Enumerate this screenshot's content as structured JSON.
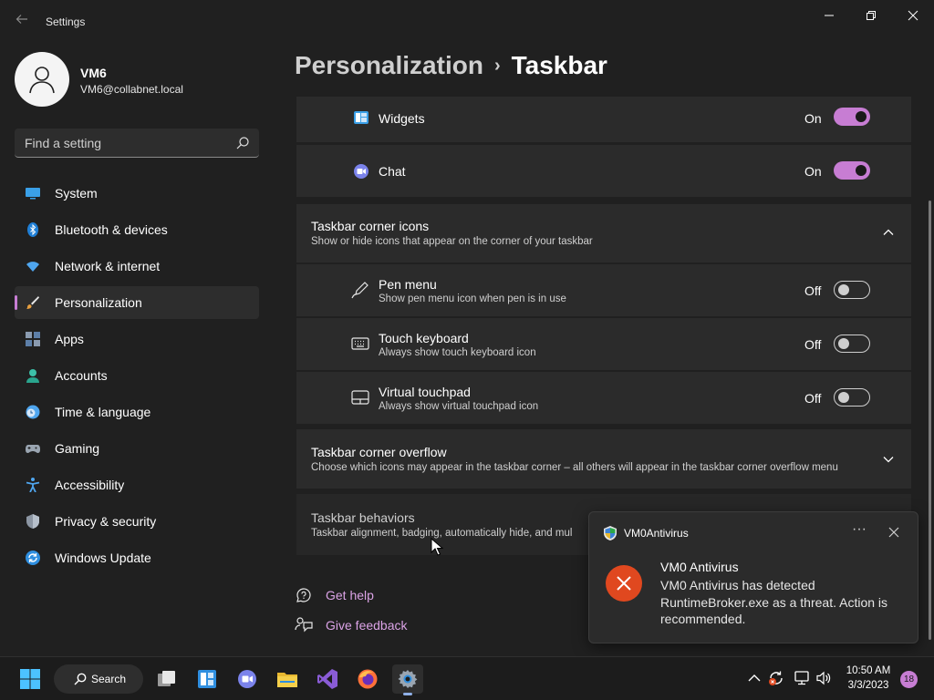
{
  "window": {
    "title": "Settings"
  },
  "user": {
    "name": "VM6",
    "email": "VM6@collabnet.local"
  },
  "search": {
    "placeholder": "Find a setting"
  },
  "sidebar": {
    "items": [
      {
        "label": "System",
        "icon": "system-icon"
      },
      {
        "label": "Bluetooth & devices",
        "icon": "bluetooth-icon"
      },
      {
        "label": "Network & internet",
        "icon": "wifi-icon"
      },
      {
        "label": "Personalization",
        "icon": "brush-icon",
        "active": true
      },
      {
        "label": "Apps",
        "icon": "apps-icon"
      },
      {
        "label": "Accounts",
        "icon": "accounts-icon"
      },
      {
        "label": "Time & language",
        "icon": "clock-icon"
      },
      {
        "label": "Gaming",
        "icon": "gamepad-icon"
      },
      {
        "label": "Accessibility",
        "icon": "accessibility-icon"
      },
      {
        "label": "Privacy & security",
        "icon": "shield-icon"
      },
      {
        "label": "Windows Update",
        "icon": "update-icon"
      }
    ]
  },
  "breadcrumb": {
    "parent": "Personalization",
    "separator": "›",
    "current": "Taskbar"
  },
  "taskbar_items": [
    {
      "label": "Widgets",
      "state": "On",
      "on": true,
      "icon": "widgets-icon"
    },
    {
      "label": "Chat",
      "state": "On",
      "on": true,
      "icon": "chat-icon"
    }
  ],
  "corner_icons": {
    "title": "Taskbar corner icons",
    "description": "Show or hide icons that appear on the corner of your taskbar",
    "expanded": true,
    "items": [
      {
        "label": "Pen menu",
        "description": "Show pen menu icon when pen is in use",
        "state": "Off",
        "on": false,
        "icon": "pen-icon"
      },
      {
        "label": "Touch keyboard",
        "description": "Always show touch keyboard icon",
        "state": "Off",
        "on": false,
        "icon": "keyboard-icon"
      },
      {
        "label": "Virtual touchpad",
        "description": "Always show virtual touchpad icon",
        "state": "Off",
        "on": false,
        "icon": "touchpad-icon"
      }
    ]
  },
  "corner_overflow": {
    "title": "Taskbar corner overflow",
    "description": "Choose which icons may appear in the taskbar corner – all others will appear in the taskbar corner overflow menu",
    "expanded": false
  },
  "behaviors": {
    "title": "Taskbar behaviors",
    "description": "Taskbar alignment, badging, automatically hide, and mul"
  },
  "help": {
    "get_help": "Get help",
    "give_feedback": "Give feedback"
  },
  "notification": {
    "app_name": "VM0Antivirus",
    "more": "···",
    "title": "VM0 Antivirus",
    "body": "VM0 Antivirus has detected RuntimeBroker.exe as a threat. Action is recommended."
  },
  "system_taskbar": {
    "search_label": "Search",
    "time": "10:50 AM",
    "date": "3/3/2023",
    "notification_count": "18",
    "pinned_apps": [
      "start-icon",
      "task-view-icon",
      "widgets-icon",
      "teams-chat-icon",
      "file-explorer-icon",
      "visual-studio-icon",
      "firefox-icon",
      "settings-gear-icon"
    ]
  },
  "colors": {
    "accent": "#c77dd3",
    "link": "#dba3e6",
    "background": "#202020",
    "card": "#2b2b2b",
    "error": "#e0481f"
  }
}
